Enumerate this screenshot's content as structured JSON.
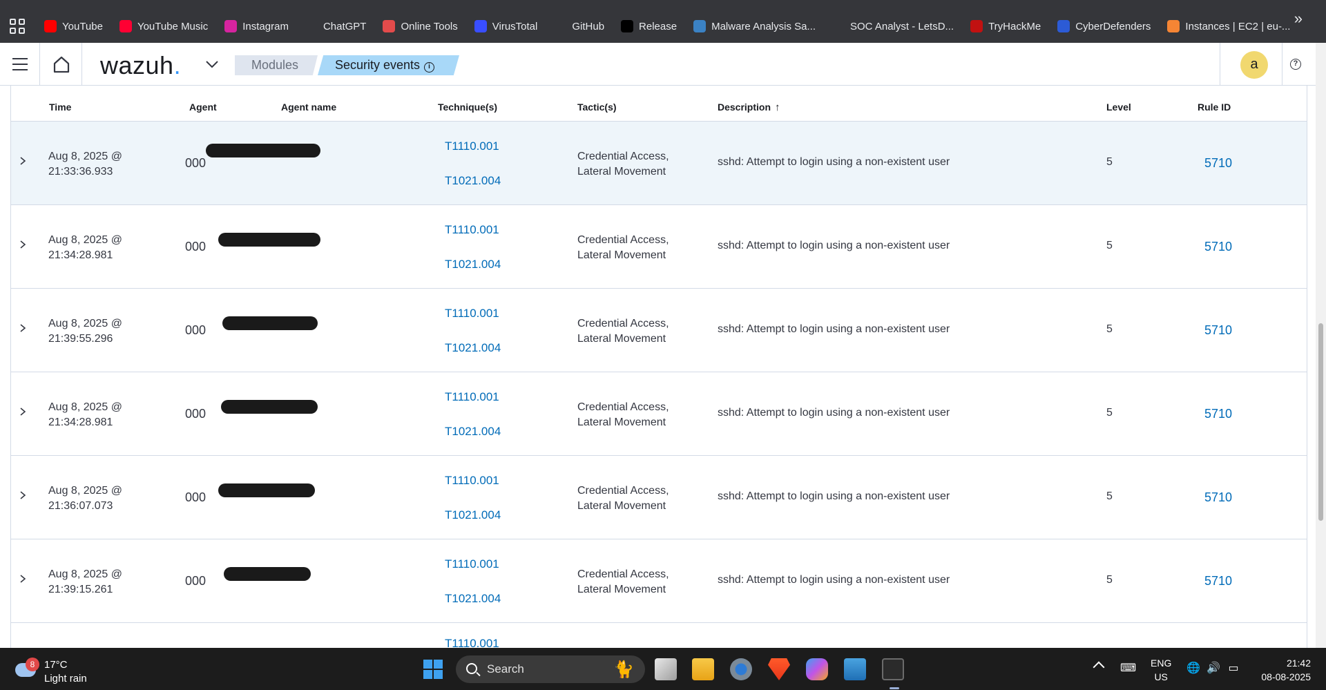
{
  "bookmarks": [
    {
      "label": "YouTube",
      "icon": "youtube-icon",
      "color": "#ff0000"
    },
    {
      "label": "YouTube Music",
      "icon": "youtube-music-icon",
      "color": "#ff0033"
    },
    {
      "label": "Instagram",
      "icon": "instagram-icon",
      "color": "#d6249f"
    },
    {
      "label": "ChatGPT",
      "icon": "chatgpt-icon",
      "color": "#35363a"
    },
    {
      "label": "Online Tools",
      "icon": "online-tools-icon",
      "color": "#e34b4b"
    },
    {
      "label": "VirusTotal",
      "icon": "virustotal-icon",
      "color": "#394eff"
    },
    {
      "label": "GitHub",
      "icon": "github-icon",
      "color": "#35363a"
    },
    {
      "label": "Release",
      "icon": "release-icon",
      "color": "#000000"
    },
    {
      "label": "Malware Analysis Sa...",
      "icon": "malware-analysis-icon",
      "color": "#3b82c4"
    },
    {
      "label": "SOC Analyst - LetsD...",
      "icon": "soc-analyst-icon",
      "color": "#35363a"
    },
    {
      "label": "TryHackMe",
      "icon": "tryhackme-icon",
      "color": "#c11111"
    },
    {
      "label": "CyberDefenders",
      "icon": "cyberdefenders-icon",
      "color": "#2c5bd6"
    },
    {
      "label": "Instances | EC2 | eu-...",
      "icon": "aws-ec2-icon",
      "color": "#f58534"
    }
  ],
  "header": {
    "logo": "wazuh",
    "logo_dot": ".",
    "breadcrumb_modules": "Modules",
    "breadcrumb_current": "Security events",
    "info_glyph": "i",
    "avatar_letter": "a",
    "help_glyph": "?"
  },
  "table": {
    "columns": {
      "time": "Time",
      "agent": "Agent",
      "agent_name": "Agent name",
      "techniques": "Technique(s)",
      "tactics": "Tactic(s)",
      "description": "Description",
      "level": "Level",
      "rule_id": "Rule ID"
    },
    "sort_glyph": "↑",
    "rows": [
      {
        "date": "Aug 8, 2025 @",
        "clock": "21:33:36.933",
        "agent": "000",
        "tech1": "T1110.001",
        "tech2": "T1021.004",
        "tactic1": "Credential Access,",
        "tactic2": "Lateral Movement",
        "description": "sshd: Attempt to login using a non-existent user",
        "level": "5",
        "rule_id": "5710"
      },
      {
        "date": "Aug 8, 2025 @",
        "clock": "21:34:28.981",
        "agent": "000",
        "tech1": "T1110.001",
        "tech2": "T1021.004",
        "tactic1": "Credential Access,",
        "tactic2": "Lateral Movement",
        "description": "sshd: Attempt to login using a non-existent user",
        "level": "5",
        "rule_id": "5710"
      },
      {
        "date": "Aug 8, 2025 @",
        "clock": "21:39:55.296",
        "agent": "000",
        "tech1": "T1110.001",
        "tech2": "T1021.004",
        "tactic1": "Credential Access,",
        "tactic2": "Lateral Movement",
        "description": "sshd: Attempt to login using a non-existent user",
        "level": "5",
        "rule_id": "5710"
      },
      {
        "date": "Aug 8, 2025 @",
        "clock": "21:34:28.981",
        "agent": "000",
        "tech1": "T1110.001",
        "tech2": "T1021.004",
        "tactic1": "Credential Access,",
        "tactic2": "Lateral Movement",
        "description": "sshd: Attempt to login using a non-existent user",
        "level": "5",
        "rule_id": "5710"
      },
      {
        "date": "Aug 8, 2025 @",
        "clock": "21:36:07.073",
        "agent": "000",
        "tech1": "T1110.001",
        "tech2": "T1021.004",
        "tactic1": "Credential Access,",
        "tactic2": "Lateral Movement",
        "description": "sshd: Attempt to login using a non-existent user",
        "level": "5",
        "rule_id": "5710"
      },
      {
        "date": "Aug 8, 2025 @",
        "clock": "21:39:15.261",
        "agent": "000",
        "tech1": "T1110.001",
        "tech2": "T1021.004",
        "tactic1": "Credential Access,",
        "tactic2": "Lateral Movement",
        "description": "sshd: Attempt to login using a non-existent user",
        "level": "5",
        "rule_id": "5710"
      },
      {
        "date": "",
        "clock": "",
        "agent": "",
        "tech1": "T1110.001",
        "tech2": "",
        "tactic1": "",
        "tactic2": "",
        "description": "",
        "level": "",
        "rule_id": ""
      }
    ]
  },
  "taskbar": {
    "weather_badge": "8",
    "temperature": "17°C",
    "condition": "Light rain",
    "search_placeholder": "Search",
    "lang_top": "ENG",
    "lang_bottom": "US",
    "time": "21:42",
    "date": "08-08-2025"
  },
  "colors": {
    "link": "#006bb8",
    "highlight_row": "#eef5fa",
    "breadcrumb_active": "#a8d8f8"
  }
}
